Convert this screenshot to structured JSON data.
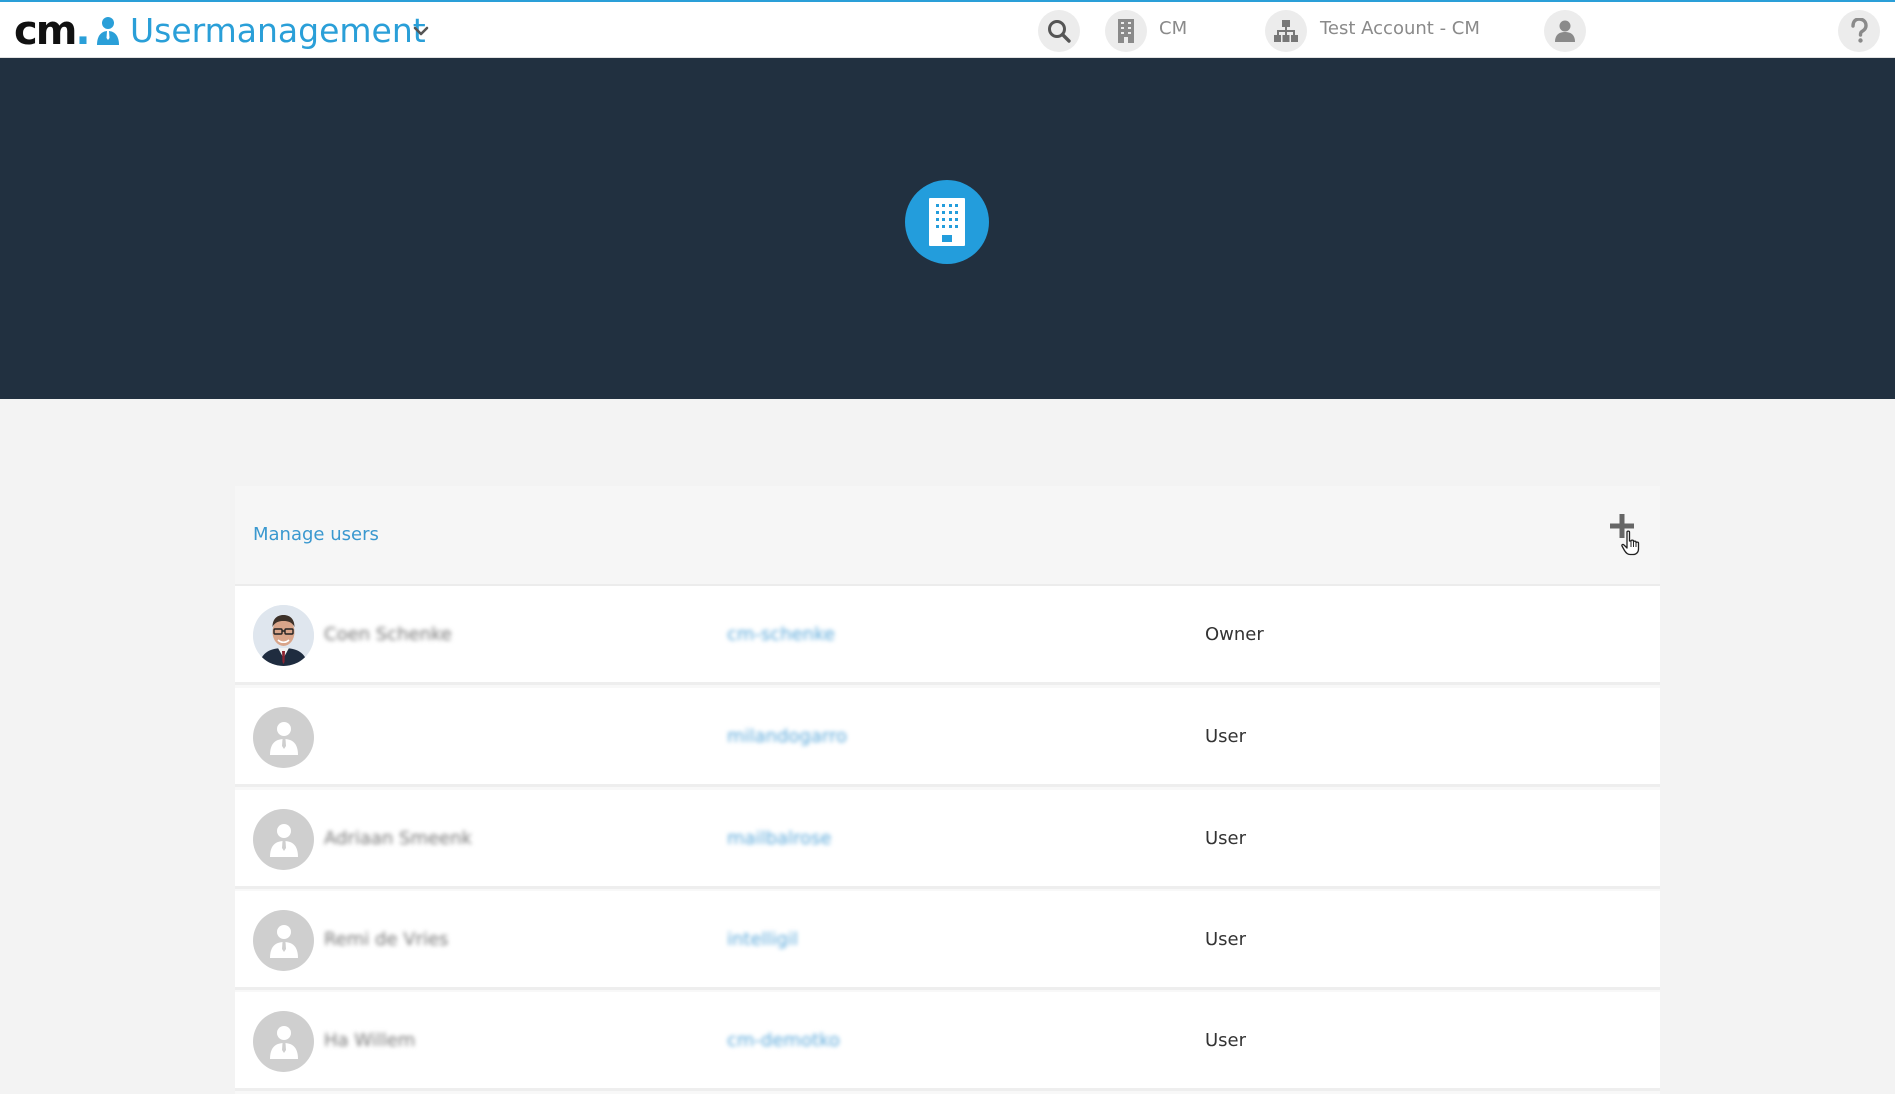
{
  "header": {
    "logo_text": "cm",
    "logo_dot": ".",
    "app_title": "Usermanagement",
    "company_label": "CM",
    "account_label": "Test Account - CM",
    "icons": [
      "user-app-icon",
      "chevron-down-icon",
      "search-icon",
      "building-icon",
      "hierarchy-icon",
      "user-icon",
      "help-icon"
    ]
  },
  "banner": {
    "icon": "building-icon",
    "colors": {
      "background": "#213040",
      "badge": "#239ddc"
    }
  },
  "panel": {
    "title": "Manage users",
    "add_icon": "plus-icon"
  },
  "users": [
    {
      "name": "Coen Schenke",
      "login": "cm-schenke",
      "role": "Owner",
      "has_photo": true
    },
    {
      "name": "",
      "login": "milandogarro",
      "role": "User",
      "has_photo": false
    },
    {
      "name": "Adriaan Smeenk",
      "login": "mailbalrose",
      "role": "User",
      "has_photo": false
    },
    {
      "name": "Remi de Vries",
      "login": "intelligil",
      "role": "User",
      "has_photo": false
    },
    {
      "name": "Ha Willem",
      "login": "cm-demotko",
      "role": "User",
      "has_photo": false
    }
  ],
  "colors": {
    "accent": "#2a9fd8",
    "page_background": "#f3f3f3"
  }
}
